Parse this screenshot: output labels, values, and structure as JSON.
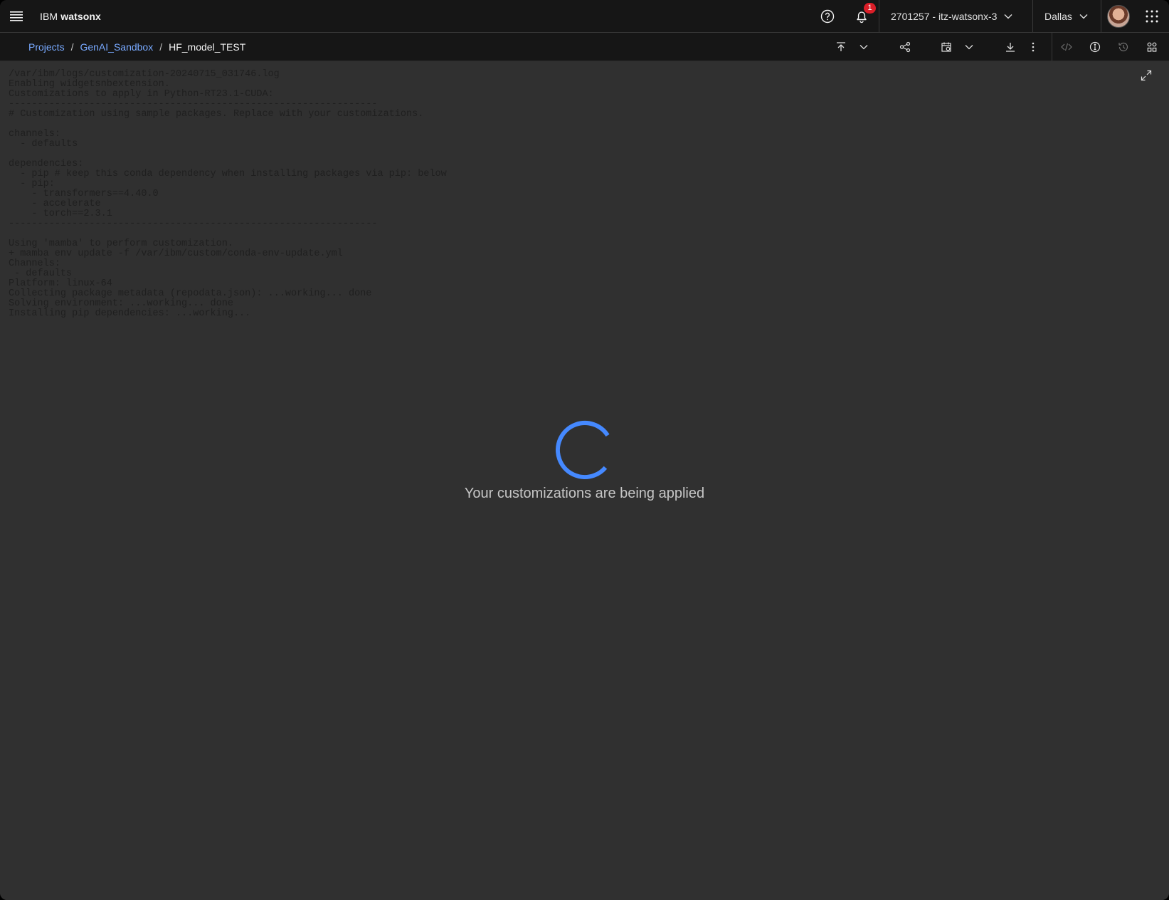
{
  "header": {
    "brand_prefix": "IBM",
    "brand_name": "watsonx",
    "notifications_count": "1",
    "account": "2701257 - itz-watsonx-3",
    "region": "Dallas"
  },
  "breadcrumb": {
    "items": [
      "Projects",
      "GenAI_Sandbox"
    ],
    "current": "HF_model_TEST"
  },
  "toolbar_icons": [
    "publish-icon",
    "chevron-down-icon",
    "share-icon",
    "schedule-icon",
    "chevron-down-icon",
    "download-icon",
    "overflow-menu-icon",
    "code-icon",
    "info-icon",
    "history-icon",
    "environment-icon"
  ],
  "log": {
    "lines": [
      "/var/ibm/logs/customization-20240715_031746.log",
      "Enabling widgetsnbextension.",
      "Customizations to apply in Python-RT23.1-CUDA:",
      "----------------------------------------------------------------",
      "# Customization using sample packages. Replace with your customizations.",
      "",
      "channels:",
      "  - defaults",
      "",
      "dependencies:",
      "  - pip # keep this conda dependency when installing packages via pip: below",
      "  - pip:",
      "    - transformers==4.40.0",
      "    - accelerate",
      "    - torch==2.3.1",
      "----------------------------------------------------------------",
      "",
      "Using 'mamba' to perform customization.",
      "+ mamba env update -f /var/ibm/custom/conda-env-update.yml",
      "Channels:",
      " - defaults",
      "Platform: linux-64",
      "Collecting package metadata (repodata.json): ...working... done",
      "Solving environment: ...working... done",
      "Installing pip dependencies: ...working..."
    ]
  },
  "loading": {
    "message": "Your customizations are being applied"
  },
  "colors": {
    "header_bg": "#161616",
    "content_bg": "#303030",
    "link": "#78a9ff",
    "spinner": "#4589ff",
    "badge": "#da1e28"
  }
}
